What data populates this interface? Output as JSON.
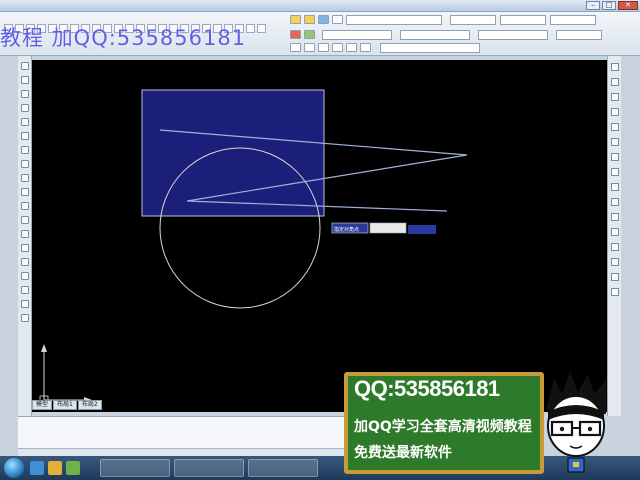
{
  "watermark": {
    "text": "教程  加QQ:535856181"
  },
  "colors": {
    "canvas_bg": "#000000",
    "rect_fill": "#1b1f7a",
    "line_color": "#9fb3d8",
    "circle_color": "#d8d8d8",
    "promo_bg": "#2d7a2b",
    "promo_border": "#c79a3a",
    "taskbar": "#2a4a70"
  },
  "drawing": {
    "tooltip_label": "指定对角点",
    "tooltip_value": ""
  },
  "model_tabs": [
    "模型",
    "布局1",
    "布局2"
  ],
  "promo": {
    "qq": "QQ:535856181",
    "line1": "加QQ学习全套高清视频教程",
    "line2": "免费送最新软件"
  },
  "taskbar": {
    "items": [
      "",
      "",
      ""
    ]
  },
  "icons": [
    "window-minimize-icon",
    "window-maximize-icon",
    "window-close-icon",
    "start-orb-icon",
    "ucs-axis-icon"
  ]
}
